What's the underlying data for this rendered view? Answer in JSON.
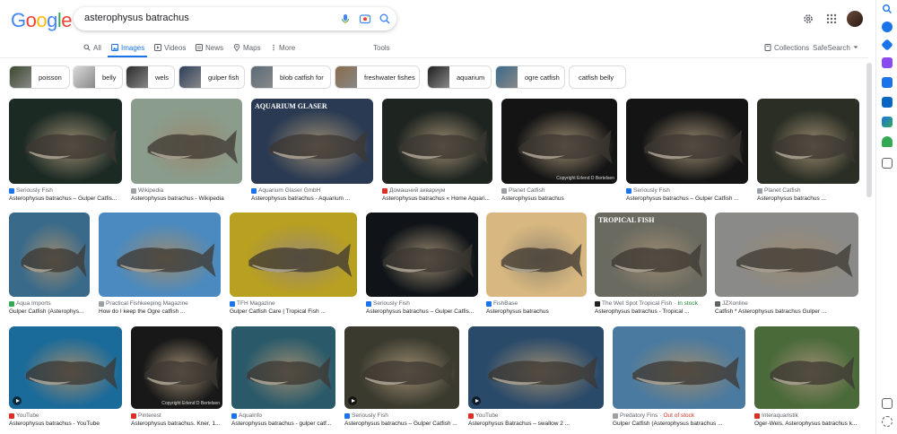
{
  "logo": "Google",
  "search": {
    "query": "asterophysus batrachus"
  },
  "tabs": [
    {
      "label": "All",
      "icon": "search-icon"
    },
    {
      "label": "Images",
      "icon": "image-icon"
    },
    {
      "label": "Videos",
      "icon": "play-icon"
    },
    {
      "label": "News",
      "icon": "news-icon"
    },
    {
      "label": "Maps",
      "icon": "location-icon"
    },
    {
      "label": "More",
      "icon": "more-icon"
    }
  ],
  "tools_label": "Tools",
  "collections_label": "Collections",
  "safesearch_label": "SafeSearch",
  "chips": [
    {
      "label": "poisson",
      "color": "#3b4a2e"
    },
    {
      "label": "belly",
      "color": "#d9d9d9"
    },
    {
      "label": "wels",
      "color": "#2a2a2a"
    },
    {
      "label": "gulper fish",
      "color": "#2d3e5a"
    },
    {
      "label": "blob catfish for",
      "color": "#5a6b78"
    },
    {
      "label": "freshwater fishes",
      "color": "#8a6b4a"
    },
    {
      "label": "aquarium",
      "color": "#1f1f1f"
    },
    {
      "label": "ogre catfish",
      "color": "#3a6a8a"
    },
    {
      "label": "catfish belly",
      "color": ""
    }
  ],
  "results": [
    {
      "source": "Seriously Fish",
      "title": "Asterophysus batrachus – Gulper Catfis...",
      "color": "#1c2a24",
      "fav": "#1a73e8"
    },
    {
      "source": "Wikipedia",
      "title": "Asterophysus batrachus - Wikipedia",
      "color": "#8a9c8c",
      "fav": "#9aa0a6"
    },
    {
      "source": "Aquarium Glaser GmbH",
      "title": "Asterophysus batrachus - Aquarium ...",
      "color": "#2a3a52",
      "fav": "#1a73e8",
      "img_text": "AQUARIUM GLASER"
    },
    {
      "source": "Домашний аквариум",
      "title": "Asterophysus batrachus « Home Aquari...",
      "color": "#1e2420",
      "fav": "#d93025"
    },
    {
      "source": "Planet Catfish",
      "title": "Asterophysus batrachus",
      "color": "#141414",
      "fav": "#9aa0a6"
    },
    {
      "source": "Seriously Fish",
      "title": "Asterophysus batrachus – Gulper Catfish ...",
      "color": "#141414",
      "fav": "#1a73e8"
    },
    {
      "source": "Planet Catfish",
      "title": "Asterophysus batrachus ...",
      "color": "#2a2e24",
      "fav": "#9aa0a6"
    },
    {
      "source": "Aqua Imports",
      "title": "Gulper Catfish (Asterophys...",
      "color": "#3a6a8a",
      "fav": "#34a853"
    },
    {
      "source": "Practical Fishkeeping Magazine",
      "title": "How do I keep the Ogre catfish ...",
      "color": "#4a8ac0",
      "fav": "#9aa0a6"
    },
    {
      "source": "TFH Magazine",
      "title": "Gulper Catfish Care | Tropical Fish ...",
      "color": "#b8a020",
      "fav": "#1a73e8"
    },
    {
      "source": "Seriously Fish",
      "title": "Asterophysus batrachus – Gulper Catfis...",
      "color": "#101418",
      "fav": "#1a73e8"
    },
    {
      "source": "FishBase",
      "title": "Asterophysus batrachus",
      "color": "#d8b880",
      "fav": "#1a73e8"
    },
    {
      "source": "The Wet Spot Tropical Fish",
      "title": "Asterophysus batrachus - Tropical ...",
      "color": "#6a6a60",
      "fav": "#202124",
      "stock": "In stock",
      "stock_class": "stock-green",
      "img_text": "TROPICAL FISH"
    },
    {
      "source": "JZXonline",
      "title": "Catfish * Asterophysus batrachus Gulper ...",
      "color": "#8a8a88",
      "fav": "#5f6368"
    },
    {
      "source": "YouTube",
      "title": "Asterophysus batrachus - YouTube",
      "color": "#1a6a9a",
      "fav": "#d93025",
      "video": true
    },
    {
      "source": "Pinterest",
      "title": "Asterophysus batrachus. Kner, 1...",
      "color": "#181818",
      "fav": "#d93025"
    },
    {
      "source": "AquaInfo",
      "title": "Asterophysus batrachus - gulper catf...",
      "color": "#2a5a6a",
      "fav": "#1a73e8"
    },
    {
      "source": "Seriously Fish",
      "title": "Asterophysus batrachus – Gulper Catfish ...",
      "color": "#3a3a2e",
      "fav": "#1a73e8",
      "video": true
    },
    {
      "source": "YouTube",
      "title": "Asterophysus Batrachus – swallow 2 ...",
      "color": "#2a4a6a",
      "fav": "#d93025",
      "video": true
    },
    {
      "source": "Predatory Fins",
      "title": "Gulper Catfish (Asterophysus batrachus ...",
      "color": "#4a7aa0",
      "fav": "#9aa0a6",
      "stock": "Out of stock",
      "stock_class": "stock-red"
    },
    {
      "source": "Interaquaristik",
      "title": "Oger-Wels, Asterophysus batrachus k...",
      "color": "#4a6a3a",
      "fav": "#d93025"
    }
  ],
  "img_watermark": "Copyright Erlend D Bertelsen"
}
